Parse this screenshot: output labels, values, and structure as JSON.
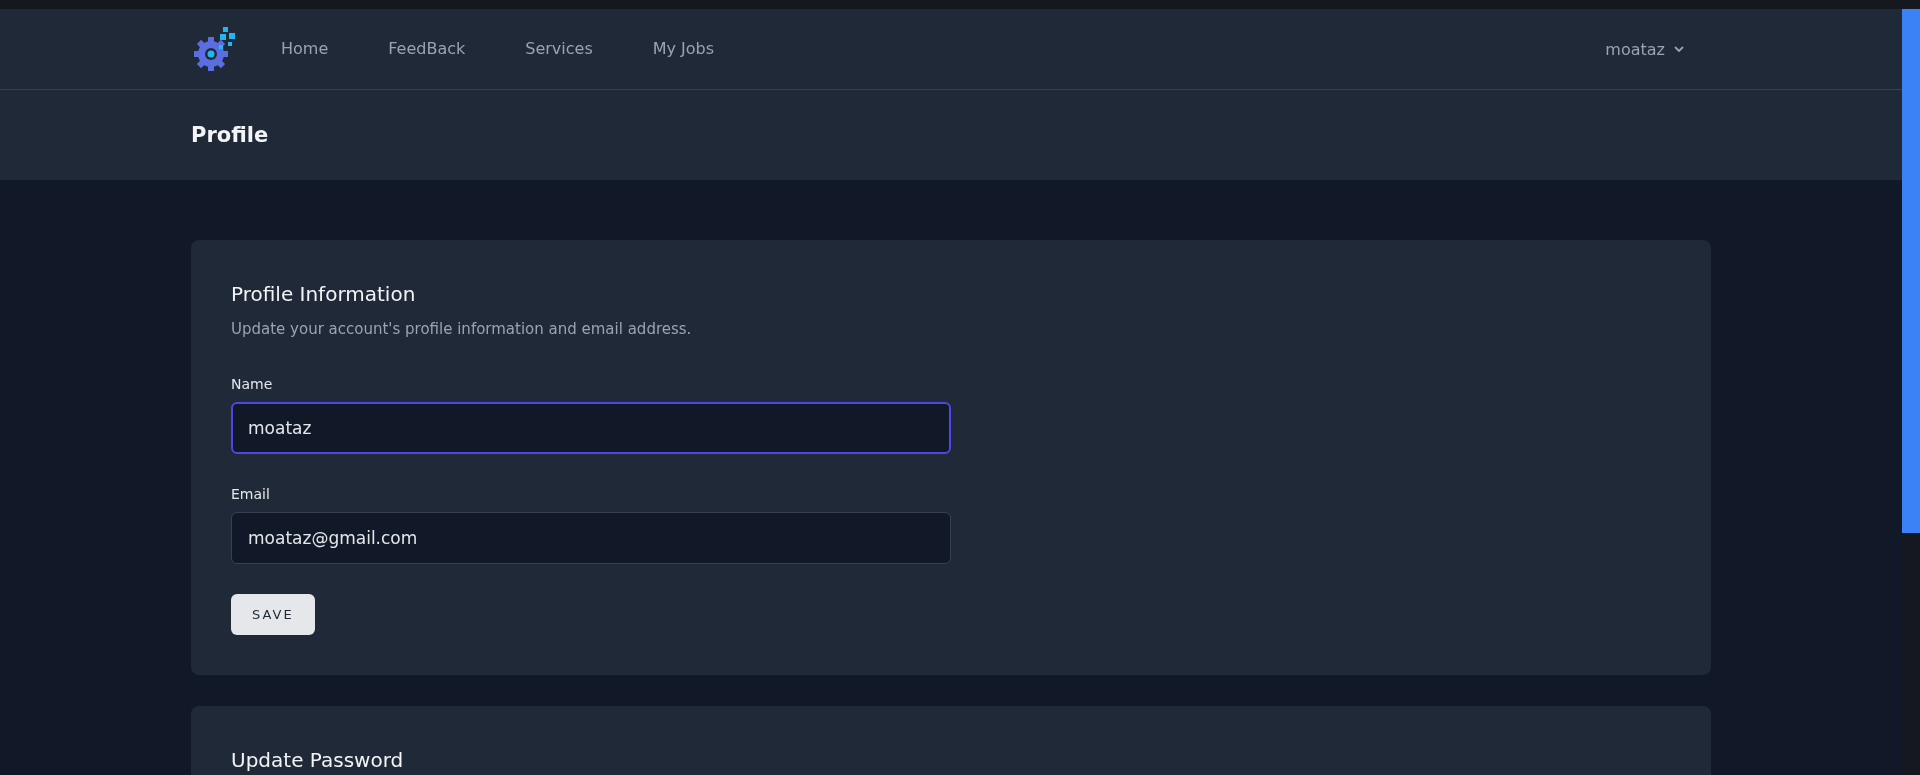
{
  "nav": {
    "items": [
      {
        "label": "Home",
        "selected": false
      },
      {
        "label": "FeedBack",
        "selected": false
      },
      {
        "label": "Services",
        "selected": false
      },
      {
        "label": "My Jobs",
        "selected": false
      }
    ],
    "user": "moataz"
  },
  "page_title": "Profile",
  "cards": [
    {
      "title": "Profile Information",
      "description": "Update your account's profile information and email address.",
      "fields": [
        {
          "label": "Name",
          "value": "moataz",
          "focused": true
        },
        {
          "label": "Email",
          "value": "moataz@gmail.com",
          "focused": false
        }
      ],
      "button": "SAVE"
    },
    {
      "title": "Update Password"
    }
  ]
}
